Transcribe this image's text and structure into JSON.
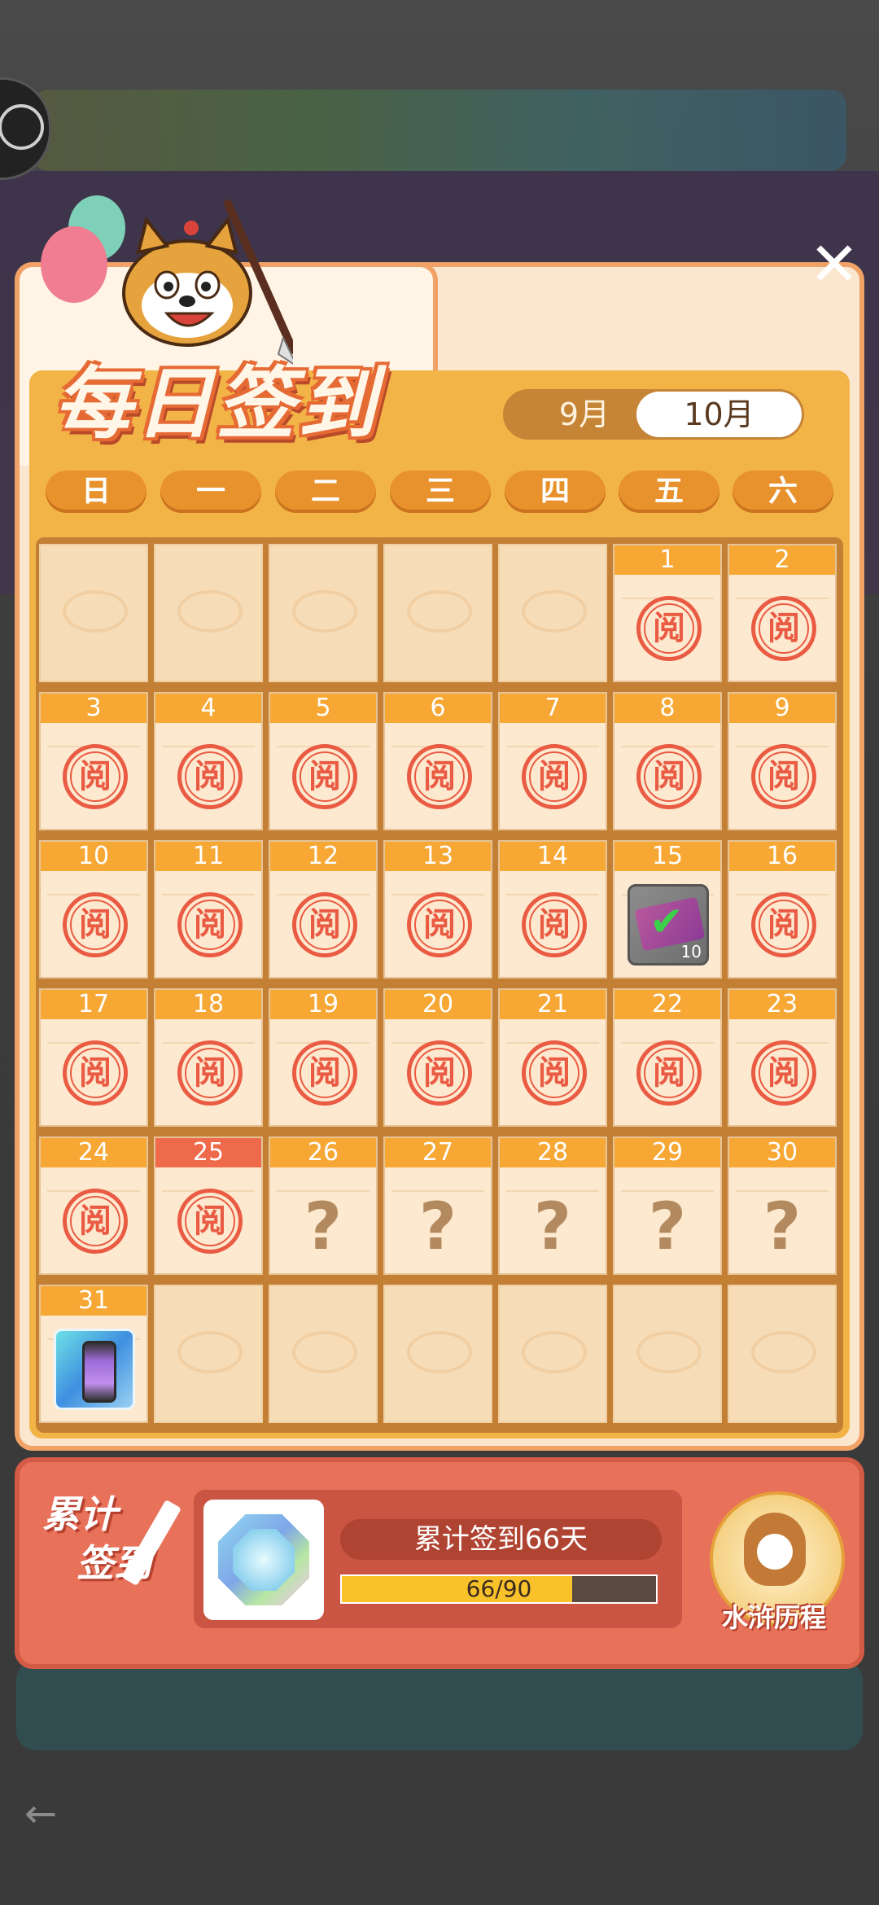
{
  "header": {
    "title": "每日签到"
  },
  "months": {
    "prev": "9月",
    "current": "10月"
  },
  "weekdays": [
    "日",
    "一",
    "二",
    "三",
    "四",
    "五",
    "六"
  ],
  "calendar": {
    "leading_empty": 5,
    "trailing_empty": 6,
    "days": [
      {
        "n": "1",
        "s": "signed"
      },
      {
        "n": "2",
        "s": "signed"
      },
      {
        "n": "3",
        "s": "signed"
      },
      {
        "n": "4",
        "s": "signed"
      },
      {
        "n": "5",
        "s": "signed"
      },
      {
        "n": "6",
        "s": "signed"
      },
      {
        "n": "7",
        "s": "signed"
      },
      {
        "n": "8",
        "s": "signed"
      },
      {
        "n": "9",
        "s": "signed"
      },
      {
        "n": "10",
        "s": "signed"
      },
      {
        "n": "11",
        "s": "signed"
      },
      {
        "n": "12",
        "s": "signed"
      },
      {
        "n": "13",
        "s": "signed"
      },
      {
        "n": "14",
        "s": "signed"
      },
      {
        "n": "15",
        "s": "reward-ticket",
        "qty": "10"
      },
      {
        "n": "16",
        "s": "signed"
      },
      {
        "n": "17",
        "s": "signed"
      },
      {
        "n": "18",
        "s": "signed"
      },
      {
        "n": "19",
        "s": "signed"
      },
      {
        "n": "20",
        "s": "signed"
      },
      {
        "n": "21",
        "s": "signed"
      },
      {
        "n": "22",
        "s": "signed"
      },
      {
        "n": "23",
        "s": "signed"
      },
      {
        "n": "24",
        "s": "signed"
      },
      {
        "n": "25",
        "s": "signed",
        "today": true
      },
      {
        "n": "26",
        "s": "unknown"
      },
      {
        "n": "27",
        "s": "unknown"
      },
      {
        "n": "28",
        "s": "unknown"
      },
      {
        "n": "29",
        "s": "unknown"
      },
      {
        "n": "30",
        "s": "unknown"
      },
      {
        "n": "31",
        "s": "reward-potion"
      }
    ],
    "stamp_text": "阅",
    "unknown_text": "?"
  },
  "cumulative": {
    "label_line1": "累计",
    "label_line2": "签到",
    "days_text": "累计签到66天",
    "progress_text": "66/90",
    "progress_value": 66,
    "progress_max": 90
  },
  "journey": {
    "label": "水浒历程"
  },
  "close": {
    "label": "✕"
  },
  "colors": {
    "accent": "#f7a733",
    "stamp": "#ea5b44",
    "today": "#ef6a4a"
  }
}
